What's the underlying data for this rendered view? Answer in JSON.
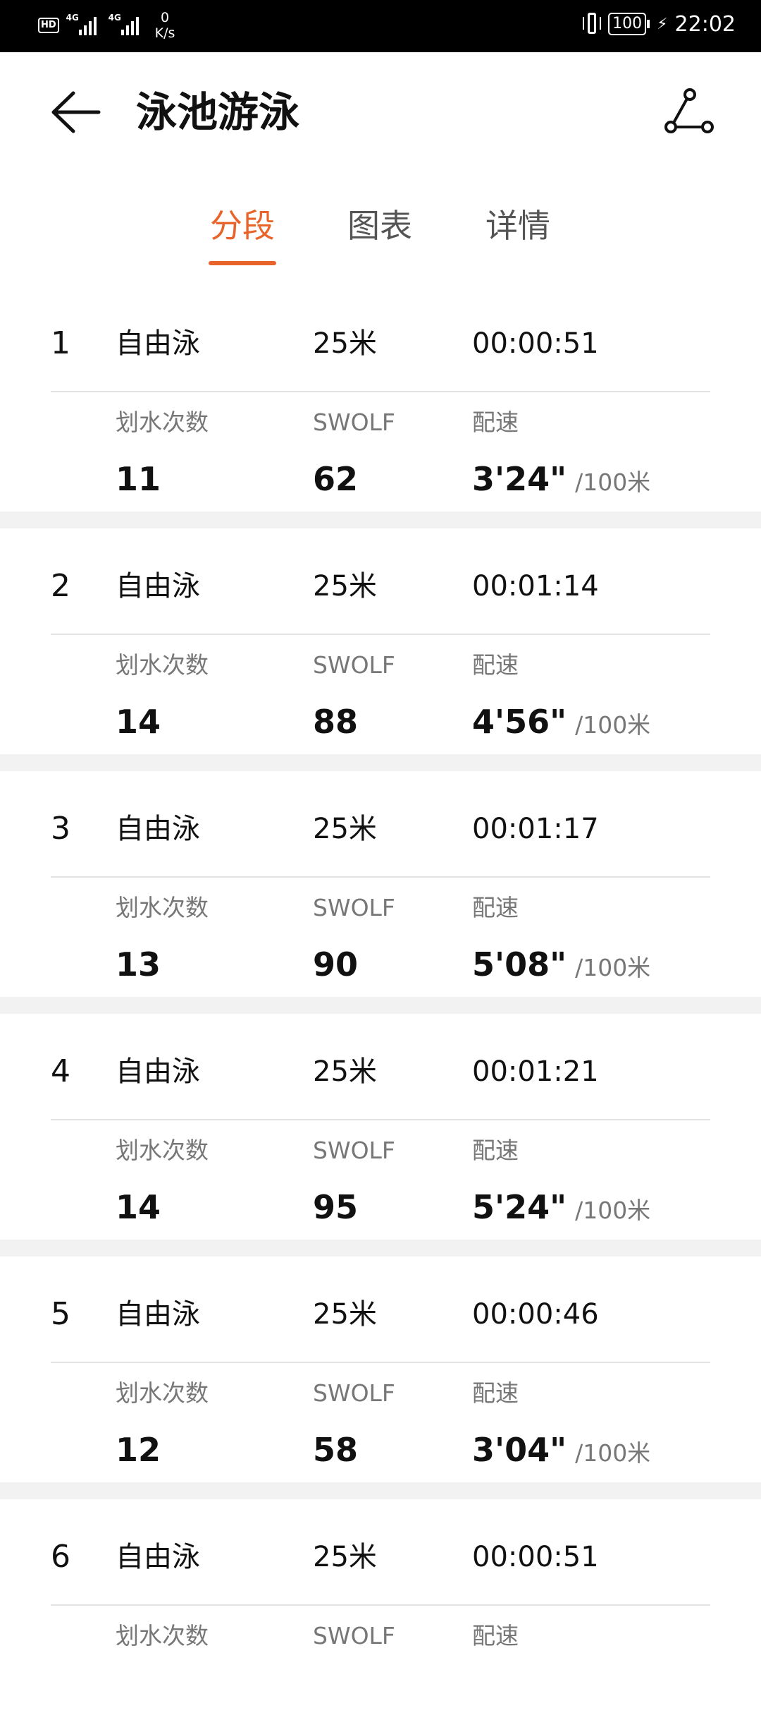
{
  "status_bar": {
    "hd": "HD",
    "net1": "4G",
    "net2": "4G",
    "speed_value": "0",
    "speed_unit": "K/s",
    "battery": "100",
    "time": "22:02"
  },
  "header": {
    "title": "泳池游泳"
  },
  "tabs": [
    {
      "label": "分段",
      "active": true
    },
    {
      "label": "图表",
      "active": false
    },
    {
      "label": "详情",
      "active": false
    }
  ],
  "labels": {
    "strokes": "划水次数",
    "swolf": "SWOLF",
    "pace": "配速",
    "pace_unit": "/100米"
  },
  "segments": [
    {
      "index": "1",
      "stroke": "自由泳",
      "distance": "25米",
      "duration": "00:00:51",
      "strokes": "11",
      "swolf": "62",
      "pace": "3'24\""
    },
    {
      "index": "2",
      "stroke": "自由泳",
      "distance": "25米",
      "duration": "00:01:14",
      "strokes": "14",
      "swolf": "88",
      "pace": "4'56\""
    },
    {
      "index": "3",
      "stroke": "自由泳",
      "distance": "25米",
      "duration": "00:01:17",
      "strokes": "13",
      "swolf": "90",
      "pace": "5'08\""
    },
    {
      "index": "4",
      "stroke": "自由泳",
      "distance": "25米",
      "duration": "00:01:21",
      "strokes": "14",
      "swolf": "95",
      "pace": "5'24\""
    },
    {
      "index": "5",
      "stroke": "自由泳",
      "distance": "25米",
      "duration": "00:00:46",
      "strokes": "12",
      "swolf": "58",
      "pace": "3'04\""
    },
    {
      "index": "6",
      "stroke": "自由泳",
      "distance": "25米",
      "duration": "00:00:51"
    }
  ],
  "colors": {
    "accent": "#e8642b",
    "text": "#111111",
    "secondary": "#777777",
    "separator": "#f2f2f2"
  }
}
